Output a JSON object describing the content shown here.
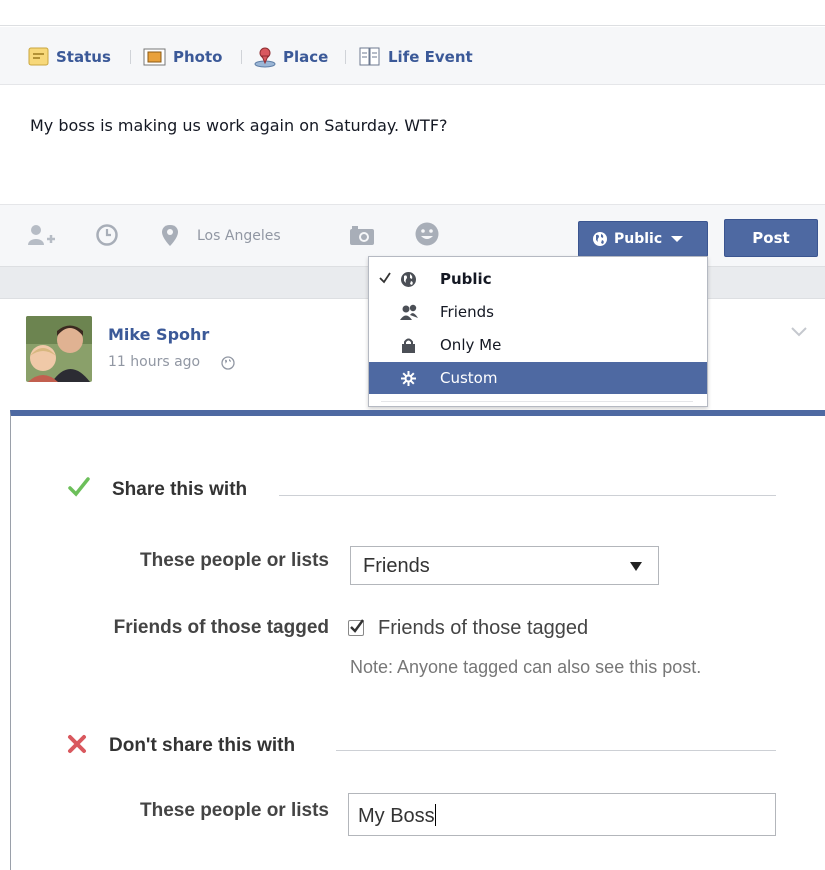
{
  "composer": {
    "tabs": [
      {
        "label": "Status",
        "icon": "status-icon"
      },
      {
        "label": "Photo",
        "icon": "photo-icon"
      },
      {
        "label": "Place",
        "icon": "place-icon"
      },
      {
        "label": "Life Event",
        "icon": "life-event-icon"
      }
    ],
    "status_text": "My boss is making us work again on Saturday. WTF?",
    "toolbar": {
      "icons": [
        "tag-friends-icon",
        "clock-icon",
        "location-pin-icon",
        "camera-icon",
        "emoji-icon"
      ],
      "location": "Los Angeles"
    },
    "audience_button": {
      "label": "Public",
      "icon": "globe-icon"
    },
    "post_button": "Post"
  },
  "audience_menu": {
    "items": [
      {
        "label": "Public",
        "icon": "globe-icon",
        "selected": true
      },
      {
        "label": "Friends",
        "icon": "friends-icon",
        "selected": false
      },
      {
        "label": "Only Me",
        "icon": "lock-icon",
        "selected": false
      },
      {
        "label": "Custom",
        "icon": "gear-icon",
        "selected": false,
        "highlighted": true
      }
    ]
  },
  "story": {
    "author": "Mike Spohr",
    "timestamp": "11 hours ago"
  },
  "custom_privacy": {
    "share": {
      "title": "Share this with",
      "people_label": "These people or lists",
      "people_value": "Friends",
      "tagged_label": "Friends of those tagged",
      "tagged_checkbox_label": "Friends of those tagged",
      "tagged_checked": true,
      "note": "Note: Anyone tagged can also see this post."
    },
    "dont_share": {
      "title": "Don't share this with",
      "people_label": "These people or lists",
      "people_value": "My Boss"
    }
  },
  "colors": {
    "brand_blue": "#3b5998",
    "button_blue": "#4e69a2",
    "check_green": "#6cbf5a",
    "cross_red": "#d9585e"
  }
}
